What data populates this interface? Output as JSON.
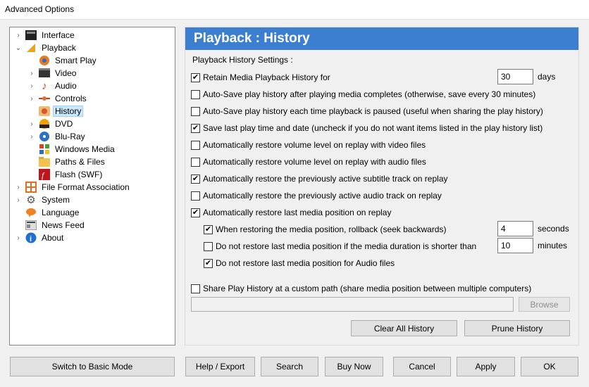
{
  "window": {
    "title": "Advanced Options"
  },
  "tree": {
    "interface": "Interface",
    "playback": "Playback",
    "smart_play": "Smart Play",
    "video": "Video",
    "audio": "Audio",
    "controls": "Controls",
    "history": "History",
    "dvd": "DVD",
    "bluray": "Blu-Ray",
    "windows_media": "Windows Media",
    "paths_files": "Paths & Files",
    "flash": "Flash (SWF)",
    "file_format": "File Format Association",
    "system": "System",
    "language": "Language",
    "news_feed": "News Feed",
    "about": "About"
  },
  "panel": {
    "title": "Playback : History",
    "section": "Playback History Settings :",
    "retain_label": "Retain Media Playback History for",
    "retain_days": "30",
    "retain_unit": "days",
    "autosave_complete": "Auto-Save play history after playing media completes (otherwise, save every 30 minutes)",
    "autosave_paused": "Auto-Save play history each time playback is paused (useful when sharing the play history)",
    "save_last_time": "Save last play time and date (uncheck if you do not want items listed in the play history list)",
    "restore_volume_video": "Automatically restore volume level on replay with video files",
    "restore_volume_audio": "Automatically restore volume level on replay with audio files",
    "restore_subtitle": "Automatically restore the previously active subtitle track on replay",
    "restore_audio_track": "Automatically restore the previously active audio track on replay",
    "restore_position": "Automatically restore last media position on replay",
    "rollback_label": "When restoring the media position, rollback (seek backwards)",
    "rollback_value": "4",
    "rollback_unit": "seconds",
    "shorter_label": "Do not restore last media position if the media duration is shorter than",
    "shorter_value": "10",
    "shorter_unit": "minutes",
    "no_audio_label": "Do not restore last media position for Audio files",
    "share_label": "Share Play History at a custom path (share media position between multiple computers)",
    "share_path": "",
    "browse": "Browse",
    "clear_all": "Clear All History",
    "prune": "Prune History"
  },
  "footer": {
    "basic_mode": "Switch to Basic Mode",
    "help_export": "Help / Export",
    "search": "Search",
    "buy_now": "Buy Now",
    "cancel": "Cancel",
    "apply": "Apply",
    "ok": "OK"
  },
  "colors": {
    "header_bg": "#3c7fd1",
    "selection_bg": "#cce8ff"
  }
}
